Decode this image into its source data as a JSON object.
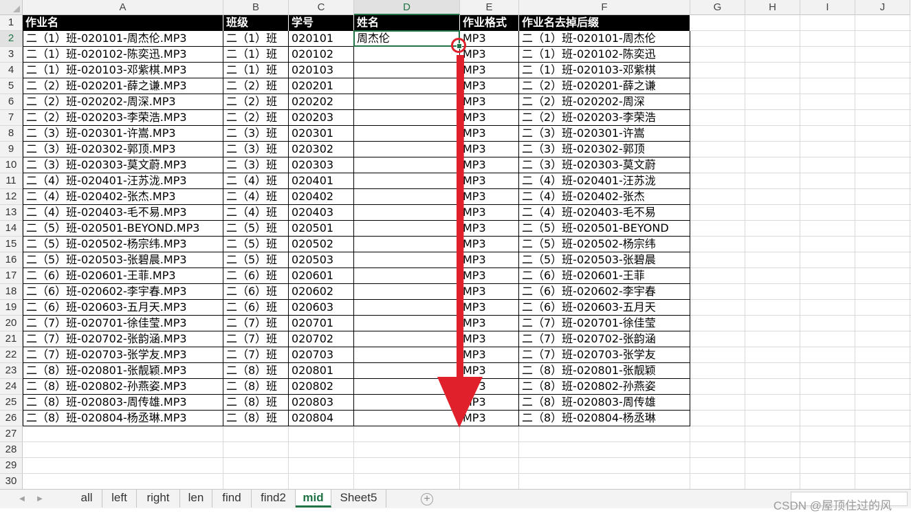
{
  "columns": [
    "A",
    "B",
    "C",
    "D",
    "E",
    "F",
    "G",
    "H",
    "I",
    "J"
  ],
  "active_column": "D",
  "active_row": 2,
  "header_row": [
    "作业名",
    "班级",
    "学号",
    "姓名",
    "作业格式",
    "作业名去掉后缀"
  ],
  "rows": [
    [
      "二（1）班-020101-周杰伦.MP3",
      "二（1）班",
      "020101",
      "周杰伦",
      "MP3",
      "二（1）班-020101-周杰伦"
    ],
    [
      "二（1）班-020102-陈奕迅.MP3",
      "二（1）班",
      "020102",
      "",
      "MP3",
      "二（1）班-020102-陈奕迅"
    ],
    [
      "二（1）班-020103-邓紫棋.MP3",
      "二（1）班",
      "020103",
      "",
      "MP3",
      "二（1）班-020103-邓紫棋"
    ],
    [
      "二（2）班-020201-薛之谦.MP3",
      "二（2）班",
      "020201",
      "",
      "MP3",
      "二（2）班-020201-薛之谦"
    ],
    [
      "二（2）班-020202-周深.MP3",
      "二（2）班",
      "020202",
      "",
      "MP3",
      "二（2）班-020202-周深"
    ],
    [
      "二（2）班-020203-李荣浩.MP3",
      "二（2）班",
      "020203",
      "",
      "MP3",
      "二（2）班-020203-李荣浩"
    ],
    [
      "二（3）班-020301-许嵩.MP3",
      "二（3）班",
      "020301",
      "",
      "MP3",
      "二（3）班-020301-许嵩"
    ],
    [
      "二（3）班-020302-郭顶.MP3",
      "二（3）班",
      "020302",
      "",
      "MP3",
      "二（3）班-020302-郭顶"
    ],
    [
      "二（3）班-020303-莫文蔚.MP3",
      "二（3）班",
      "020303",
      "",
      "MP3",
      "二（3）班-020303-莫文蔚"
    ],
    [
      "二（4）班-020401-汪苏泷.MP3",
      "二（4）班",
      "020401",
      "",
      "MP3",
      "二（4）班-020401-汪苏泷"
    ],
    [
      "二（4）班-020402-张杰.MP3",
      "二（4）班",
      "020402",
      "",
      "MP3",
      "二（4）班-020402-张杰"
    ],
    [
      "二（4）班-020403-毛不易.MP3",
      "二（4）班",
      "020403",
      "",
      "MP3",
      "二（4）班-020403-毛不易"
    ],
    [
      "二（5）班-020501-BEYOND.MP3",
      "二（5）班",
      "020501",
      "",
      "MP3",
      "二（5）班-020501-BEYOND"
    ],
    [
      "二（5）班-020502-杨宗纬.MP3",
      "二（5）班",
      "020502",
      "",
      "MP3",
      "二（5）班-020502-杨宗纬"
    ],
    [
      "二（5）班-020503-张碧晨.MP3",
      "二（5）班",
      "020503",
      "",
      "MP3",
      "二（5）班-020503-张碧晨"
    ],
    [
      "二（6）班-020601-王菲.MP3",
      "二（6）班",
      "020601",
      "",
      "MP3",
      "二（6）班-020601-王菲"
    ],
    [
      "二（6）班-020602-李宇春.MP3",
      "二（6）班",
      "020602",
      "",
      "MP3",
      "二（6）班-020602-李宇春"
    ],
    [
      "二（6）班-020603-五月天.MP3",
      "二（6）班",
      "020603",
      "",
      "MP3",
      "二（6）班-020603-五月天"
    ],
    [
      "二（7）班-020701-徐佳莹.MP3",
      "二（7）班",
      "020701",
      "",
      "MP3",
      "二（7）班-020701-徐佳莹"
    ],
    [
      "二（7）班-020702-张韵涵.MP3",
      "二（7）班",
      "020702",
      "",
      "MP3",
      "二（7）班-020702-张韵涵"
    ],
    [
      "二（7）班-020703-张学友.MP3",
      "二（7）班",
      "020703",
      "",
      "MP3",
      "二（7）班-020703-张学友"
    ],
    [
      "二（8）班-020801-张靓颖.MP3",
      "二（8）班",
      "020801",
      "",
      "MP3",
      "二（8）班-020801-张靓颖"
    ],
    [
      "二（8）班-020802-孙燕姿.MP3",
      "二（8）班",
      "020802",
      "",
      "MP3",
      "二（8）班-020802-孙燕姿"
    ],
    [
      "二（8）班-020803-周传雄.MP3",
      "二（8）班",
      "020803",
      "",
      "MP3",
      "二（8）班-020803-周传雄"
    ],
    [
      "二（8）班-020804-杨丞琳.MP3",
      "二（8）班",
      "020804",
      "",
      "MP3",
      "二（8）班-020804-杨丞琳"
    ]
  ],
  "row_numbers": [
    "1",
    "2",
    "3",
    "4",
    "5",
    "6",
    "7",
    "8",
    "9",
    "10",
    "11",
    "12",
    "13",
    "14",
    "15",
    "16",
    "17",
    "18",
    "19",
    "20",
    "21",
    "22",
    "23",
    "24",
    "25",
    "26",
    "27",
    "28",
    "29",
    "30"
  ],
  "sheet_tabs": [
    "all",
    "left",
    "right",
    "len",
    "find",
    "find2",
    "mid",
    "Sheet5"
  ],
  "active_tab": "mid",
  "add_sheet_label": "+",
  "watermark": "CSDN @屋顶住过的风",
  "colors": {
    "accent": "#217346",
    "annotation_red": "#e0202a",
    "header_fill": "#000000"
  },
  "icons": {
    "tab_prev": "caret-left-icon",
    "tab_next": "caret-right-icon",
    "add_sheet": "plus-circle-icon",
    "annotation": "down-arrow-icon"
  }
}
